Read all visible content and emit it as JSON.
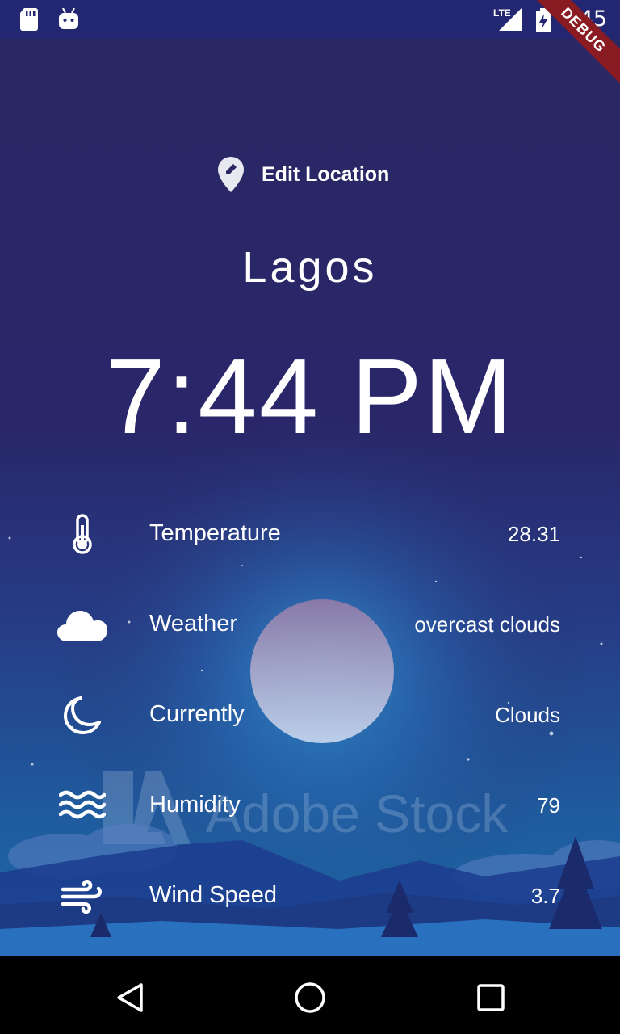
{
  "status_bar": {
    "time": "7:45",
    "network": "LTE",
    "debug_banner": "DEBUG"
  },
  "header": {
    "edit_location_label": "Edit Location",
    "edit_location_icon": "location-edit-icon"
  },
  "main": {
    "city": "Lagos",
    "time": "7:44 PM",
    "rows": [
      {
        "label": "Temperature",
        "value": "28.31",
        "icon": "thermometer-icon"
      },
      {
        "label": "Weather",
        "value": "overcast clouds",
        "icon": "cloud-icon"
      },
      {
        "label": "Currently",
        "value": "Clouds",
        "icon": "moon-icon"
      },
      {
        "label": "Humidity",
        "value": "79",
        "icon": "waves-icon"
      },
      {
        "label": "Wind Speed",
        "value": "3.7",
        "icon": "wind-icon"
      }
    ]
  },
  "background": {
    "watermark": "Adobe Stock"
  },
  "colors": {
    "status_bar": "#232772",
    "background_top": "#2a2763",
    "background_bottom": "#1b6aa8",
    "debug_banner": "#8a1b22",
    "text": "#ffffff"
  }
}
